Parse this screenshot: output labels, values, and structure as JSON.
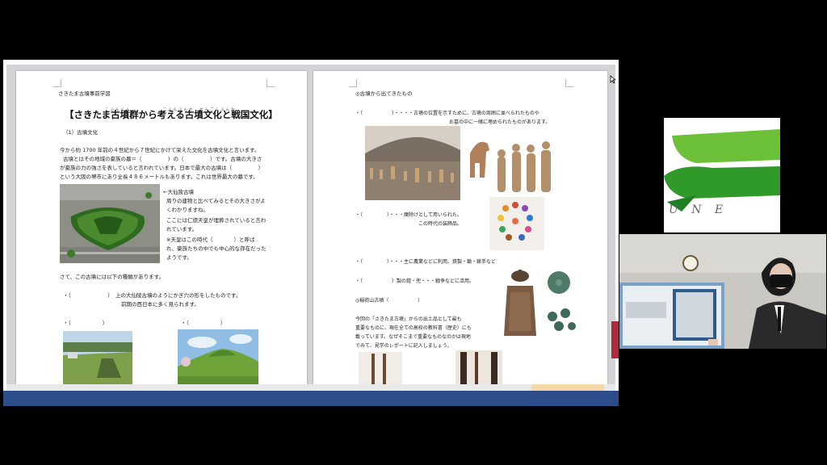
{
  "document": {
    "left_page": {
      "header": "さきたま古墳事前学習",
      "title": "【さきたま古墳群から考える古墳文化と戦国文化】",
      "title_ruby": "こふんぐん　　　　　　こふんぶんか　せんごくぶんか",
      "section1": "（1）古墳文化",
      "p1": "今から約 1700 年前の４世紀から７世紀にかけて栄えた文化を古墳文化と言います。",
      "p2": "古墳とはその地域の豪族の墓＝（　　　　　）の（　　　　　）です。古墳の大きさ",
      "p3": "が豪族の力の強さを表していると言われています。日本で最大の古墳は（　　　　　）",
      "p4": "という大阪の堺市にあり全長４８６メートルもあります。これは世界最大の墓です。",
      "side1": "←大仙陵古墳",
      "side2": "周りの建物と比べてみるとその大きさがよ",
      "side3": "くわかりますね。",
      "side4": "ここには仁徳天皇が埋葬されていると言わ",
      "side5": "れています。",
      "side6": "※天皇はこの時代（　　　　）と呼ば",
      "side7": "れ、豪族たちの中でも中心的な存在だった",
      "side8": "ようです。",
      "p5": "さて、この古墳には以下の種類があります。",
      "p6": "・（　　　　　　　）　上の大仙陵古墳のようにかぎ穴の形をしたものです。",
      "p7": "前期の西日本に多く見られます。",
      "bullet_a": "・（　　　　　　）",
      "bullet_b": "・（　　　　　　）"
    },
    "right_page": {
      "header": "◎古墳から出てきたもの",
      "r1": "・（　　　　　　）・・・・古墳の位置を示すために、古墳の周囲に並べられたものや",
      "r2": "お墓の中に一緒に埋められたものがあります。",
      "r3": "・（　　　　　）・・・魔除けとして用いられた。",
      "r4": "この時代の装飾品。",
      "r5": "・（　　　　　）・・・主に農業などに利用。鉄製・鋤・鍬手など",
      "r6": "・（　　　　　　）製の鎧・兜・・・戦争などに活用。",
      "r7": "◎稲荷山古墳（　　　　　　）",
      "r8": "今回の「さきたま古墳」からの出土品として最も",
      "r9": "重要なものに、現在全ての高校の教科書（歴史）にも",
      "r10": "載っています。なぜそこまで重要なものなのかは現地",
      "r11": "でみて、見学のレポートに記入しましょう。"
    }
  },
  "logo": {
    "text": "U N E"
  },
  "colors": {
    "accent": "#2c4d8a",
    "logo_green": "#4cae2a"
  }
}
